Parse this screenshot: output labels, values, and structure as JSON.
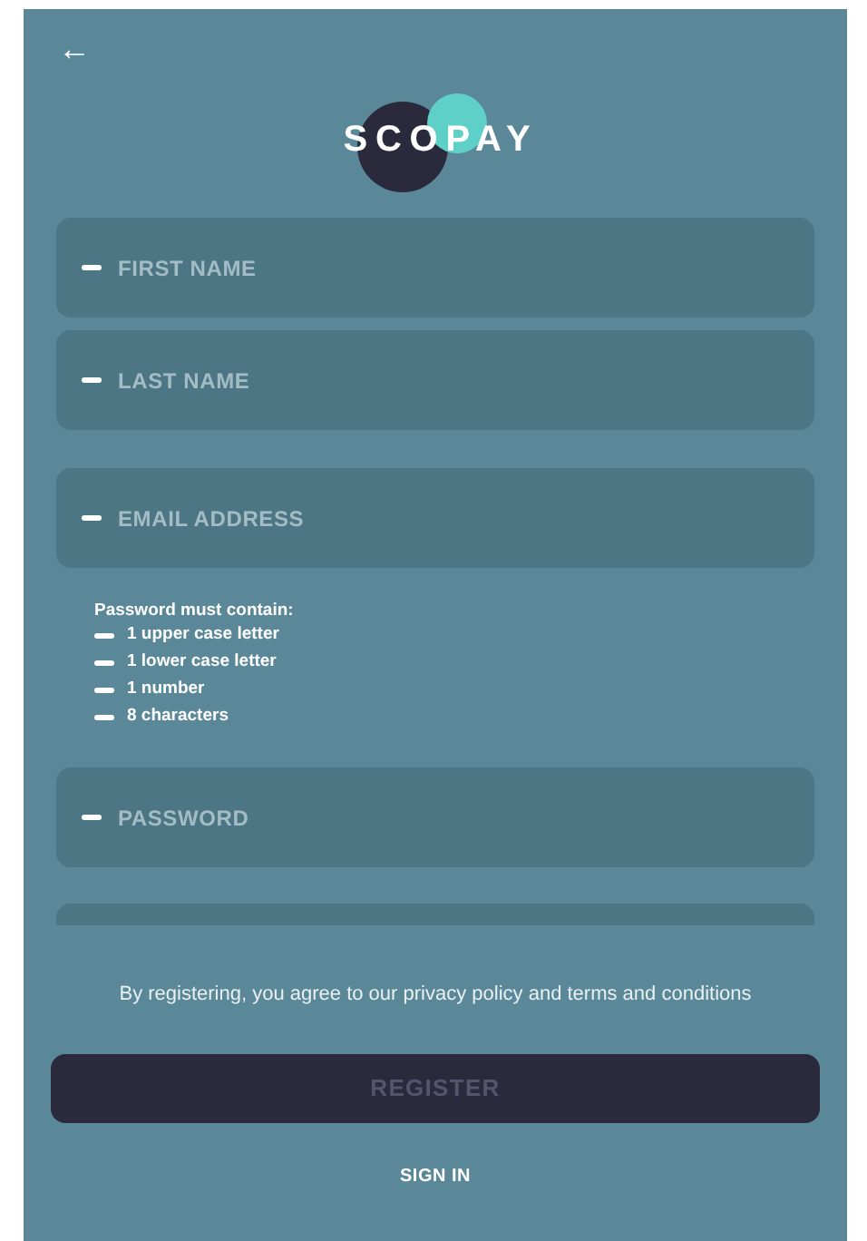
{
  "header": {
    "back": "←",
    "logo": "SCOPAY"
  },
  "form": [
    {
      "kind": "field",
      "placeholder": "FIRST NAME"
    },
    {
      "kind": "field",
      "placeholder": "LAST NAME"
    },
    {
      "kind": "field",
      "placeholder": "EMAIL ADDRESS"
    },
    {
      "kind": "rules",
      "title": "Password must contain:",
      "rules": [
        "1 upper case letter",
        "1 lower case letter",
        "1 number",
        "8 characters"
      ]
    },
    {
      "kind": "field",
      "placeholder": "PASSWORD"
    },
    {
      "kind": "field"
    }
  ],
  "terms": "By registering, you agree to our privacy policy and terms and conditions",
  "register": {
    "label": "REGISTER",
    "disabled": true
  },
  "sign_in": "SIGN IN"
}
